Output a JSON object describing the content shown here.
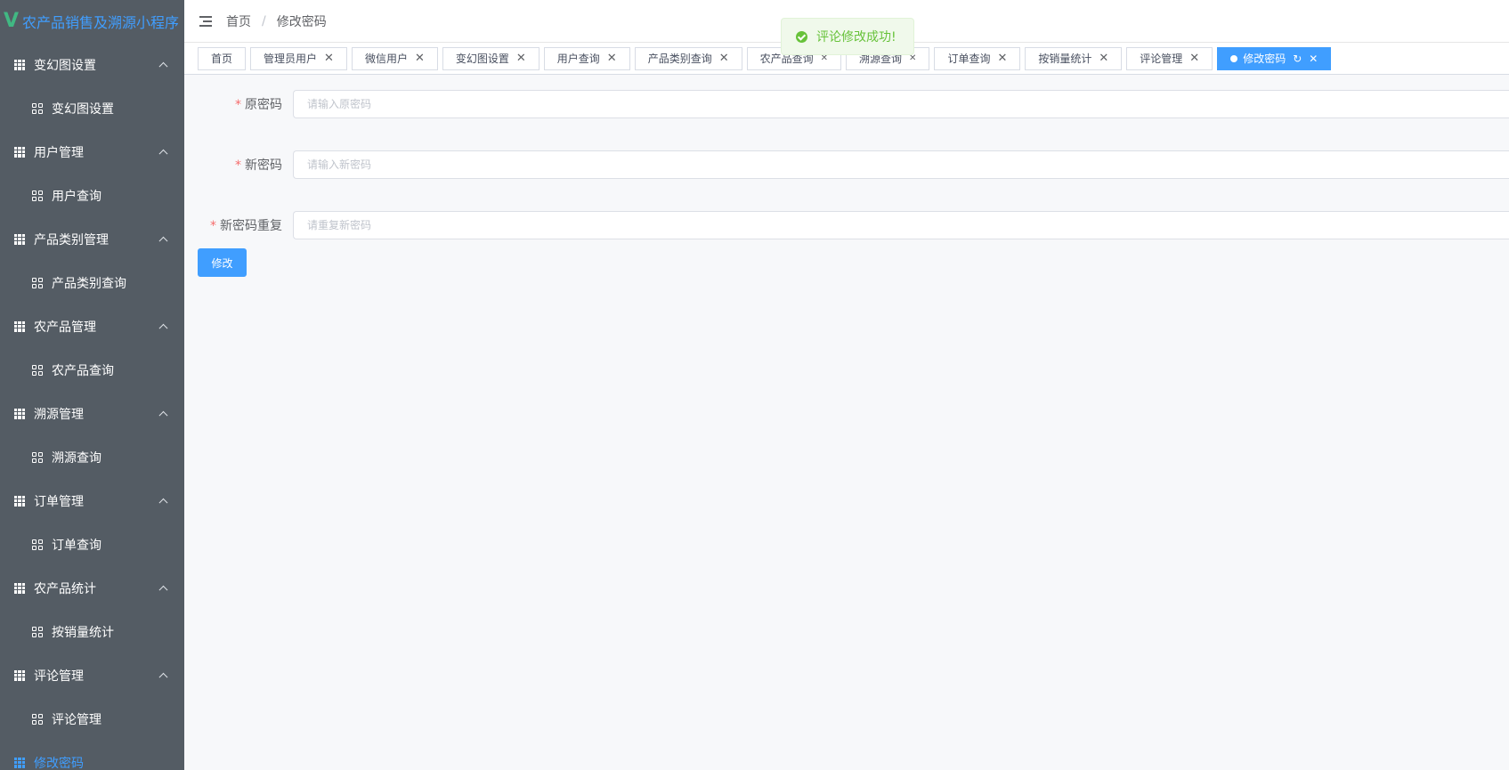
{
  "app": {
    "logo_letter": "V",
    "title": "农产品销售及溯源小程序"
  },
  "sidebar": {
    "groups": [
      {
        "label": "变幻图设置",
        "sub": "变幻图设置"
      },
      {
        "label": "用户管理",
        "sub": "用户查询"
      },
      {
        "label": "产品类别管理",
        "sub": "产品类别查询"
      },
      {
        "label": "农产品管理",
        "sub": "农产品查询"
      },
      {
        "label": "溯源管理",
        "sub": "溯源查询"
      },
      {
        "label": "订单管理",
        "sub": "订单查询"
      },
      {
        "label": "农产品统计",
        "sub": "按销量统计"
      },
      {
        "label": "评论管理",
        "sub": "评论管理"
      }
    ],
    "active_item": "修改密码"
  },
  "breadcrumb": {
    "home": "首页",
    "separator": "/",
    "current": "修改密码"
  },
  "toast": {
    "message": "评论修改成功!",
    "color": "#67c23a"
  },
  "tags": [
    {
      "label": "首页",
      "closable": false
    },
    {
      "label": "管理员用户",
      "closable": true
    },
    {
      "label": "微信用户",
      "closable": true
    },
    {
      "label": "变幻图设置",
      "closable": true
    },
    {
      "label": "用户查询",
      "closable": true
    },
    {
      "label": "产品类别查询",
      "closable": true
    },
    {
      "label": "农产品查询",
      "closable": true
    },
    {
      "label": "溯源查询",
      "closable": true
    },
    {
      "label": "订单查询",
      "closable": true
    },
    {
      "label": "按销量统计",
      "closable": true
    },
    {
      "label": "评论管理",
      "closable": true
    },
    {
      "label": "修改密码",
      "closable": true,
      "active": true
    }
  ],
  "form": {
    "required_mark": "*",
    "old_password": {
      "label": "原密码",
      "placeholder": "请输入原密码",
      "value": ""
    },
    "new_password": {
      "label": "新密码",
      "placeholder": "请输入新密码",
      "value": ""
    },
    "repeat_password": {
      "label": "新密码重复",
      "placeholder": "请重复新密码",
      "value": ""
    },
    "submit_label": "修改"
  },
  "colors": {
    "sidebar_bg": "#545c64",
    "accent": "#409eff",
    "required": "#f56c6c"
  }
}
